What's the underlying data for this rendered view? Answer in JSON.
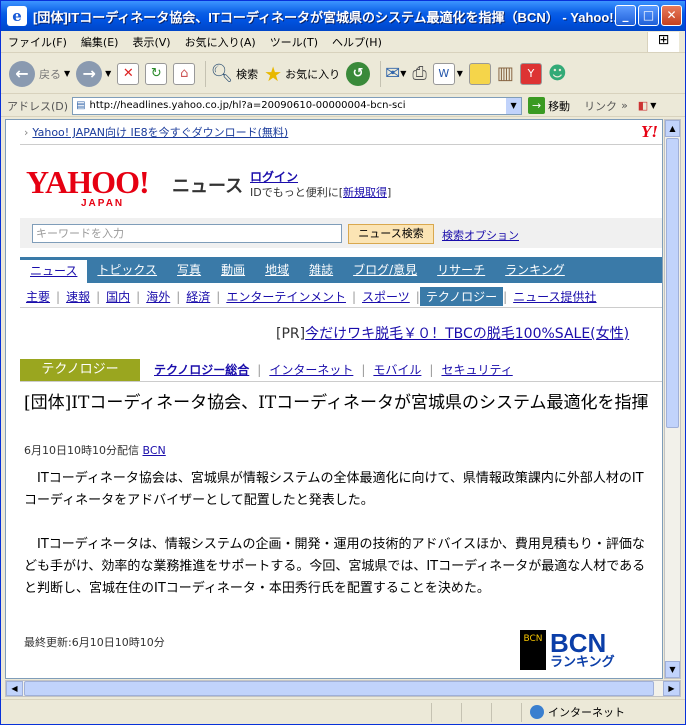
{
  "window": {
    "title": "[団体]ITコーディネータ協会、ITコーディネータが宮城県のシステム最適化を指揮（BCN） - Yahoo!..."
  },
  "menu": [
    "ファイル(F)",
    "編集(E)",
    "表示(V)",
    "お気に入り(A)",
    "ツール(T)",
    "ヘルプ(H)"
  ],
  "toolbar": {
    "back": "戻る",
    "search": "検索",
    "favorites": "お気に入り"
  },
  "address": {
    "label": "アドレス(D)",
    "url": "http://headlines.yahoo.co.jp/hl?a=20090610-00000004-bcn-sci",
    "go": "移動",
    "links": "リンク"
  },
  "status": {
    "zone": "インターネット"
  },
  "page": {
    "ie8": "Yahoo! JAPAN向け IE8を今すぐダウンロード(無料)",
    "logo": "YAHOO!",
    "logo_sub": "JAPAN",
    "logo_small": "Y!",
    "section": "ニュース",
    "login": "ログイン",
    "login_sub": "IDでもっと便利に[",
    "register": "新規取得",
    "login_close": "]",
    "search_placeholder": "キーワードを入力",
    "search_btn": "ニュース検索",
    "search_opt": "検索オプション",
    "nav": [
      "ニュース",
      "トピックス",
      "写真",
      "動画",
      "地域",
      "雑誌",
      "ブログ/意見",
      "リサーチ",
      "ランキング"
    ],
    "subnav": [
      "主要",
      "速報",
      "国内",
      "海外",
      "経済",
      "エンターテインメント",
      "スポーツ",
      "テクノロジー",
      "ニュース提供社"
    ],
    "pr_label": "[PR]",
    "pr_text": "今だけワキ脱毛￥０！TBCの脱毛100%SALE(女性)",
    "category": "テクノロジー",
    "cats": [
      "テクノロジー総合",
      "インターネット",
      "モバイル",
      "セキュリティ"
    ],
    "headline": "[団体]ITコーディネータ協会、ITコーディネータが宮城県のシステム最適化を指揮",
    "date": "6月10日10時10分配信",
    "source": "BCN",
    "p1": "　ITコーディネータ協会は、宮城県が情報システムの全体最適化に向けて、県情報政策課内に外部人材のITコーディネータをアドバイザーとして配置したと発表した。",
    "p2": "　ITコーディネータは、情報システムの企画・開発・運用の技術的アドバイスほか、費用見積もり・評価なども手がけ、効率的な業務推進をサポートする。今回、宮城県では、ITコーディネータが最適な人材であると判断し、宮城在住のITコーディネータ・本田秀行氏を配置することを決めた。",
    "updated": "最終更新:6月10日10時10分",
    "bcn": "BCN",
    "bcn_sub": "ランキング",
    "bcn_badge": "BCN"
  }
}
